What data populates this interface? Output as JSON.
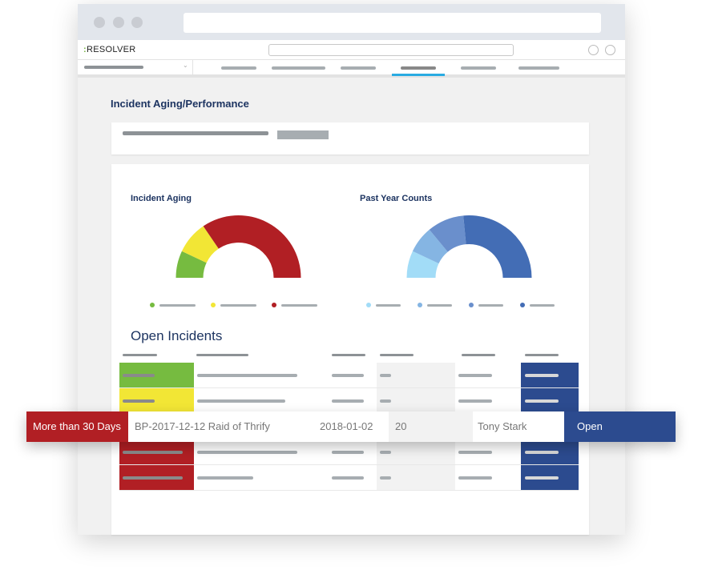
{
  "app": {
    "logo": "RESOLVER",
    "logo_prefix": ":"
  },
  "page": {
    "title": "Incident Aging/Performance"
  },
  "charts": [
    {
      "title": "Incident Aging",
      "type": "half-donut",
      "shares": [
        14,
        17,
        69
      ],
      "colors": [
        "#76bb40",
        "#f2e635",
        "#b11f24"
      ]
    },
    {
      "title": "Past Year Counts",
      "type": "half-donut",
      "shares": [
        14,
        14,
        19,
        53
      ],
      "colors": [
        "#a2dcf7",
        "#85b5e3",
        "#6a8fcc",
        "#436db5"
      ]
    }
  ],
  "table": {
    "title": "Open Incidents",
    "row_status_colors": [
      "#76bb40",
      "#f2e635",
      "#b11f24",
      "#b11f24",
      "#b11f24"
    ],
    "highlighted_row": {
      "status": "More than 30 Days",
      "name": "BP-2017-12-12 Raid of Thrify",
      "date": "2018-01-02",
      "count": "20",
      "owner": "Tony Stark",
      "state": "Open"
    }
  },
  "colors": {
    "accent": "#29abe2",
    "status_blue": "#2c4b8f",
    "red": "#b11f24",
    "title": "#1d3461"
  }
}
